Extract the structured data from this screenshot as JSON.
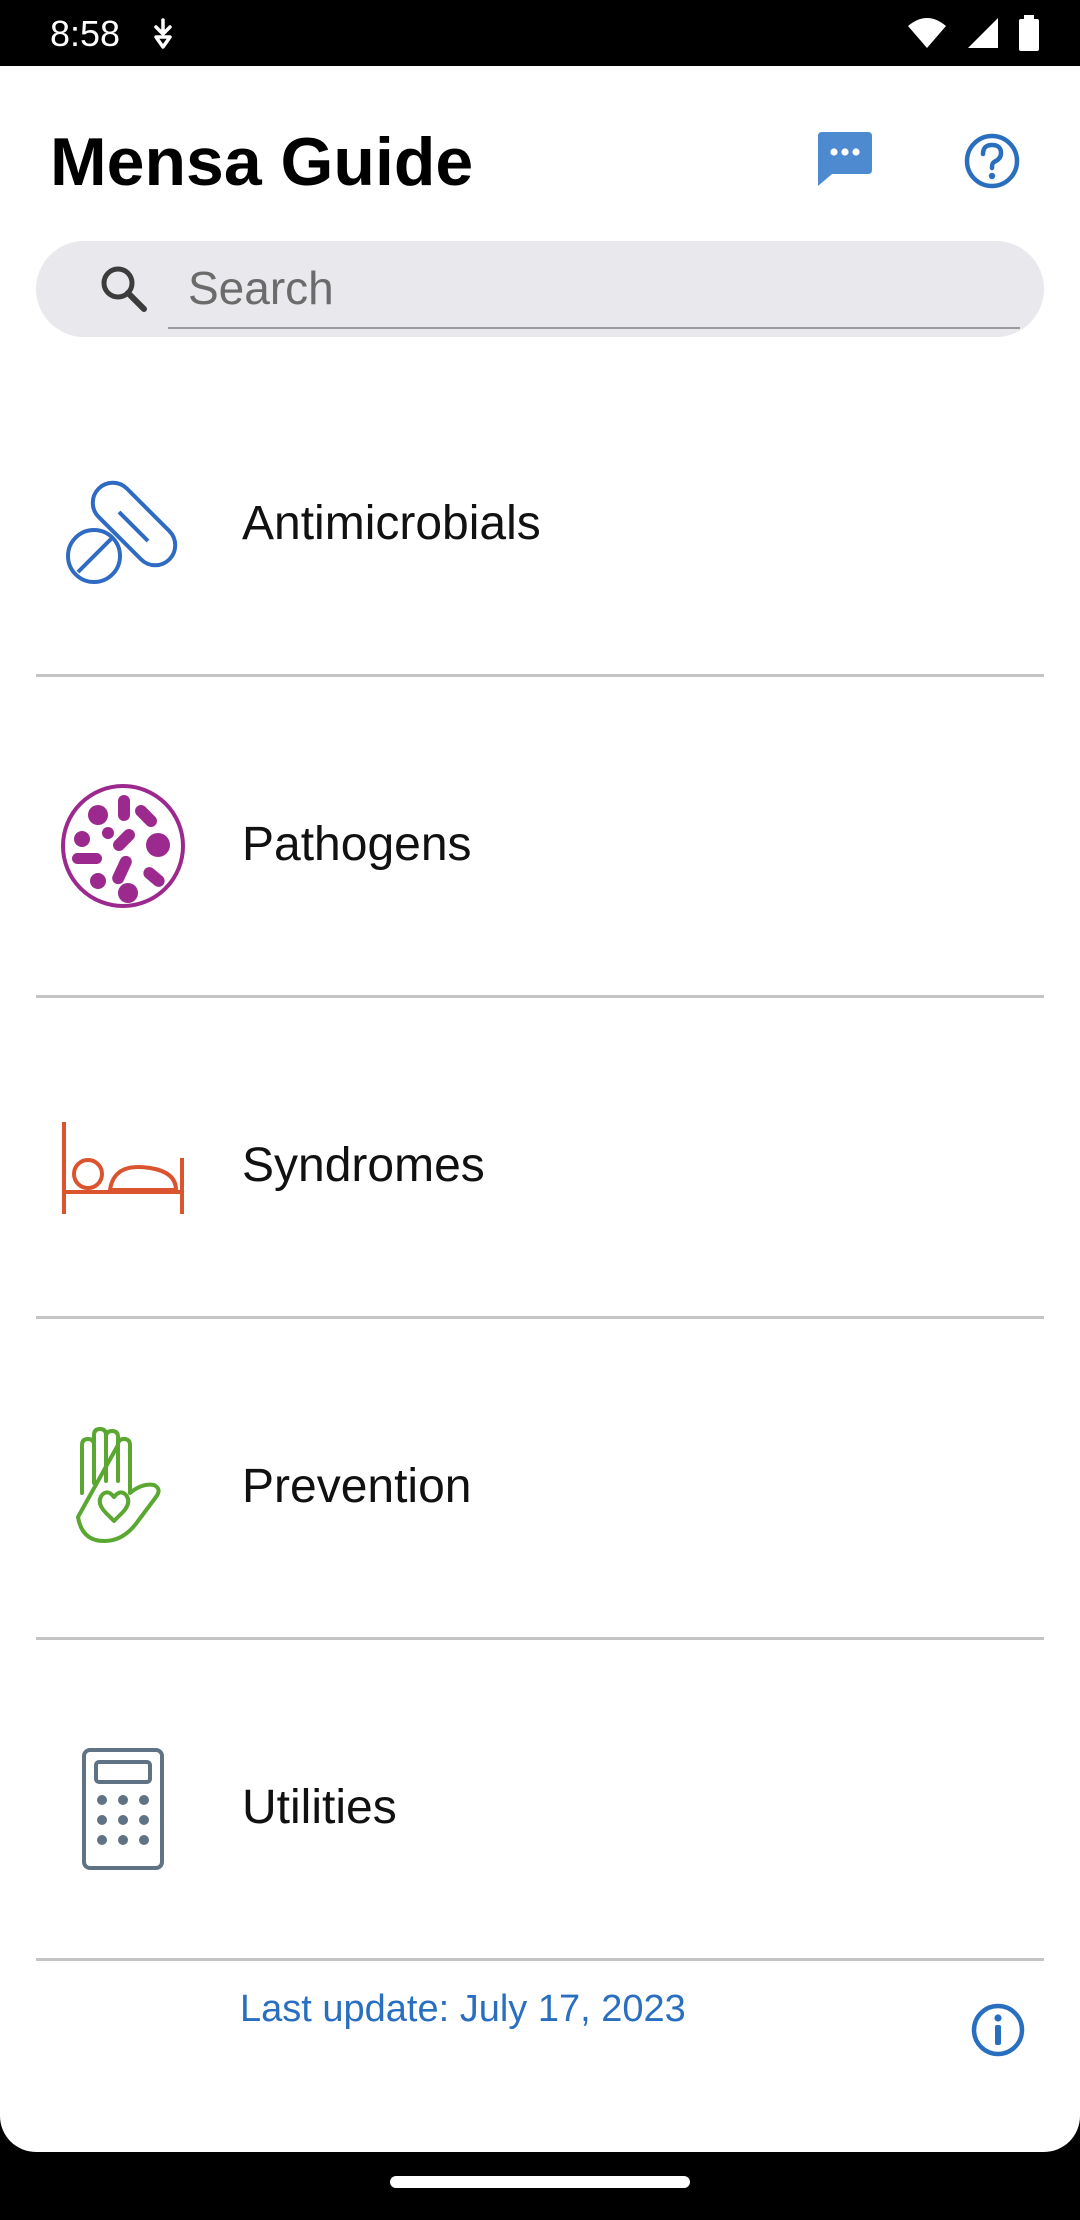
{
  "status_bar": {
    "time": "8:58"
  },
  "header": {
    "title": "Mensa Guide"
  },
  "search": {
    "placeholder": "Search"
  },
  "menu": {
    "items": [
      {
        "label": "Antimicrobials",
        "icon": "pills-icon",
        "color": "#2f6bc2"
      },
      {
        "label": "Pathogens",
        "icon": "pathogen-icon",
        "color": "#9c2a8e"
      },
      {
        "label": "Syndromes",
        "icon": "bed-icon",
        "color": "#d9542f"
      },
      {
        "label": "Prevention",
        "icon": "hand-heart-icon",
        "color": "#5aa832"
      },
      {
        "label": "Utilities",
        "icon": "calculator-icon",
        "color": "#5f7385"
      }
    ]
  },
  "footer": {
    "last_update": "Last update: July 17, 2023"
  },
  "colors": {
    "accent": "#2a6fbf",
    "chat": "#4d8ad0"
  }
}
